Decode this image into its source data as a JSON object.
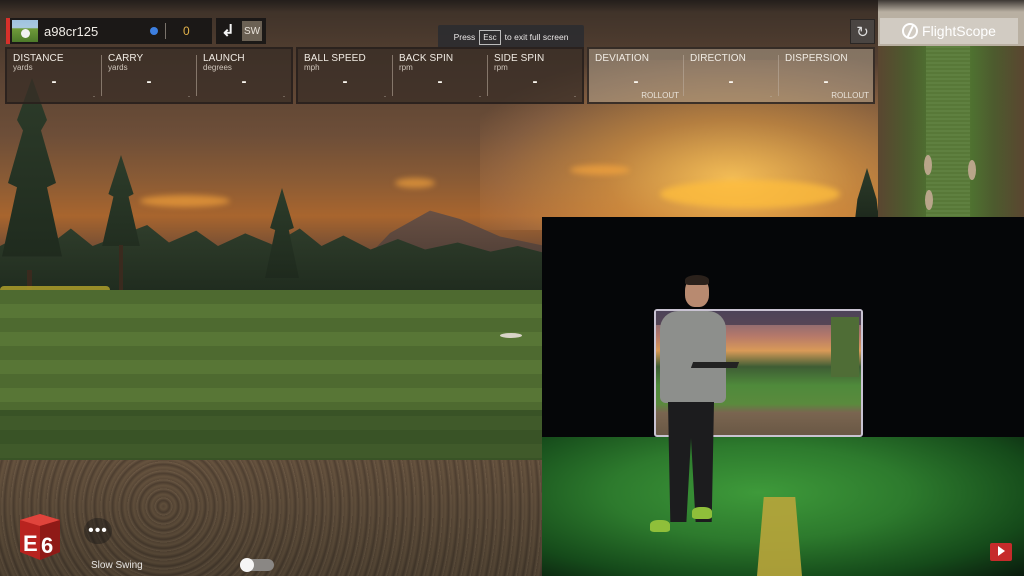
{
  "player": {
    "name": "a98cr125",
    "score": "0",
    "club": "SW"
  },
  "fullscreen_tip": {
    "prefix": "Press",
    "key": "Esc",
    "suffix": "to exit full screen"
  },
  "panels": [
    {
      "metrics": [
        {
          "label": "DISTANCE",
          "unit": "yards",
          "value": "-",
          "sub": "-"
        },
        {
          "label": "CARRY",
          "unit": "yards",
          "value": "-",
          "sub": "-"
        },
        {
          "label": "LAUNCH",
          "unit": "degrees",
          "value": "-",
          "sub": "-"
        }
      ]
    },
    {
      "metrics": [
        {
          "label": "BALL SPEED",
          "unit": "mph",
          "value": "-",
          "sub": "-"
        },
        {
          "label": "BACK SPIN",
          "unit": "rpm",
          "value": "-",
          "sub": "-"
        },
        {
          "label": "SIDE SPIN",
          "unit": "rpm",
          "value": "-",
          "sub": "-"
        }
      ]
    },
    {
      "metrics": [
        {
          "label": "DEVIATION",
          "value": "-",
          "rollout": "ROLLOUT"
        },
        {
          "label": "DIRECTION",
          "value": "-",
          "sub": "-"
        },
        {
          "label": "DISPERSION",
          "value": "-",
          "rollout": "ROLLOUT"
        }
      ]
    }
  ],
  "brand": {
    "name": "FlightScope"
  },
  "icons": {
    "reset": "↻",
    "club_arrow": "↲",
    "more": "•••"
  },
  "bottom": {
    "logo": "E6",
    "slow_swing_label": "Slow Swing",
    "slow_swing_on": false
  },
  "colors": {
    "accent_red": "#d8302a",
    "score_gold": "#e2b24a",
    "status_blue": "#3d7fe0"
  }
}
